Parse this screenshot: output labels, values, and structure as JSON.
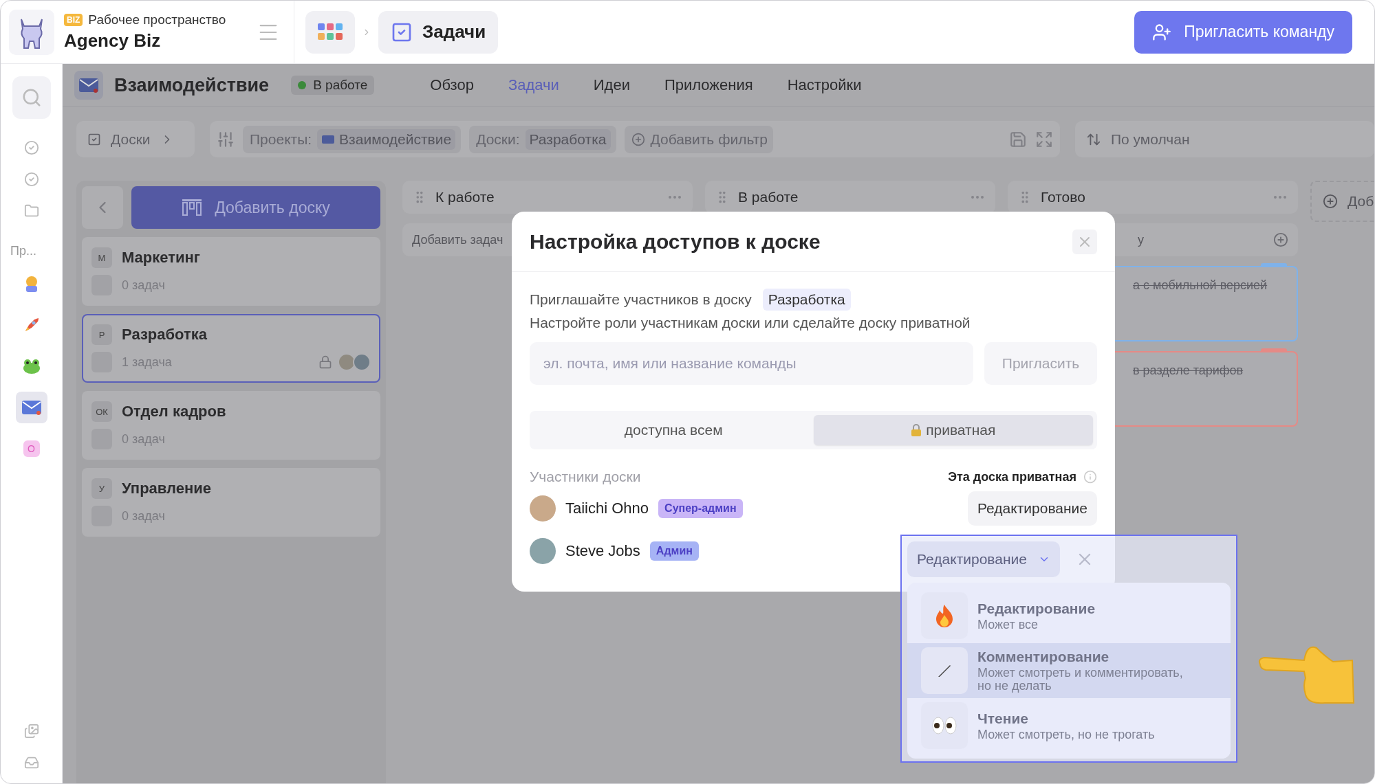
{
  "workspace": {
    "badge": "BIZ",
    "label": "Рабочее пространство",
    "name": "Agency Biz"
  },
  "breadcrumb": {
    "current": "Задачи"
  },
  "invite_team_button": "Пригласить команду",
  "rail": {
    "section_label": "Пр...",
    "projects": [
      {
        "kind": "avatar",
        "selected": false
      },
      {
        "kind": "rocket",
        "selected": false
      },
      {
        "kind": "frog",
        "selected": false
      },
      {
        "kind": "mail",
        "selected": true
      },
      {
        "kind": "letter",
        "letter": "О",
        "selected": false
      }
    ]
  },
  "project": {
    "title": "Взаимодействие",
    "status": "В работе"
  },
  "nav": [
    {
      "label": "Обзор",
      "selected": false
    },
    {
      "label": "Задачи",
      "selected": true
    },
    {
      "label": "Идеи",
      "selected": false
    },
    {
      "label": "Приложения",
      "selected": false
    },
    {
      "label": "Настройки",
      "selected": false
    }
  ],
  "toolbar": {
    "boards_button": "Доски",
    "filters": [
      {
        "label": "Проекты:",
        "value": "Взаимодействие",
        "icon": true
      },
      {
        "label": "Доски:",
        "value": "Разработка",
        "icon": false
      }
    ],
    "add_filter": "Добавить фильтр",
    "sort": "По умолчан"
  },
  "board_list": {
    "add_button": "Добавить доску",
    "boards": [
      {
        "letter": "М",
        "name": "Маркетинг",
        "count": "0 задач",
        "selected": false,
        "private": false
      },
      {
        "letter": "Р",
        "name": "Разработка",
        "count": "1 задача",
        "selected": true,
        "private": true
      },
      {
        "letter": "ОК",
        "name": "Отдел кадров",
        "count": "0 задач",
        "selected": false,
        "private": false
      },
      {
        "letter": "У",
        "name": "Управление",
        "count": "0 задач",
        "selected": false,
        "private": false
      }
    ]
  },
  "columns": [
    {
      "title": "К работе",
      "add_placeholder": "Добавить задач"
    },
    {
      "title": "В работе"
    },
    {
      "title": "Готово",
      "add_placeholder": "у",
      "cards": [
        {
          "text": "а с мобильной версией",
          "color": "#7fb2ea"
        },
        {
          "text": "в разделе тарифов",
          "color": "#e58a86"
        }
      ]
    }
  ],
  "add_column": "Доб",
  "modal": {
    "title": "Настройка доступов к доске",
    "intro": "Приглашайте участников в доску",
    "board_tag": "Разработка",
    "hint": "Настройте роли участникам доски или сделайте доску приватной",
    "invite_placeholder": "эл. почта, имя или название команды",
    "invite_button": "Пригласить",
    "visibility": [
      {
        "label": "доступна всем",
        "selected": false,
        "locked": false
      },
      {
        "label": "приватная",
        "selected": true,
        "locked": true
      }
    ],
    "members_label": "Участники доски",
    "private_note": "Эта доска приватная",
    "members": [
      {
        "name": "Taiichi Ohno",
        "badge": "Супер-админ",
        "color": "#c9b5f7",
        "role": "Редактирование",
        "open": false
      },
      {
        "name": "Steve Jobs",
        "badge": "Админ",
        "color": "#a6b3f5",
        "role": "Редактирование",
        "open": true
      }
    ]
  },
  "role_menu": [
    {
      "kind": "fire",
      "title": "Редактирование",
      "description": "Может все",
      "selected": false
    },
    {
      "kind": "pen",
      "title": "Комментирование",
      "description": "Может смотреть и комментировать, но не делать",
      "selected": true
    },
    {
      "kind": "eyes",
      "title": "Чтение",
      "description": "Может смотреть, но не трогать",
      "selected": false
    }
  ]
}
